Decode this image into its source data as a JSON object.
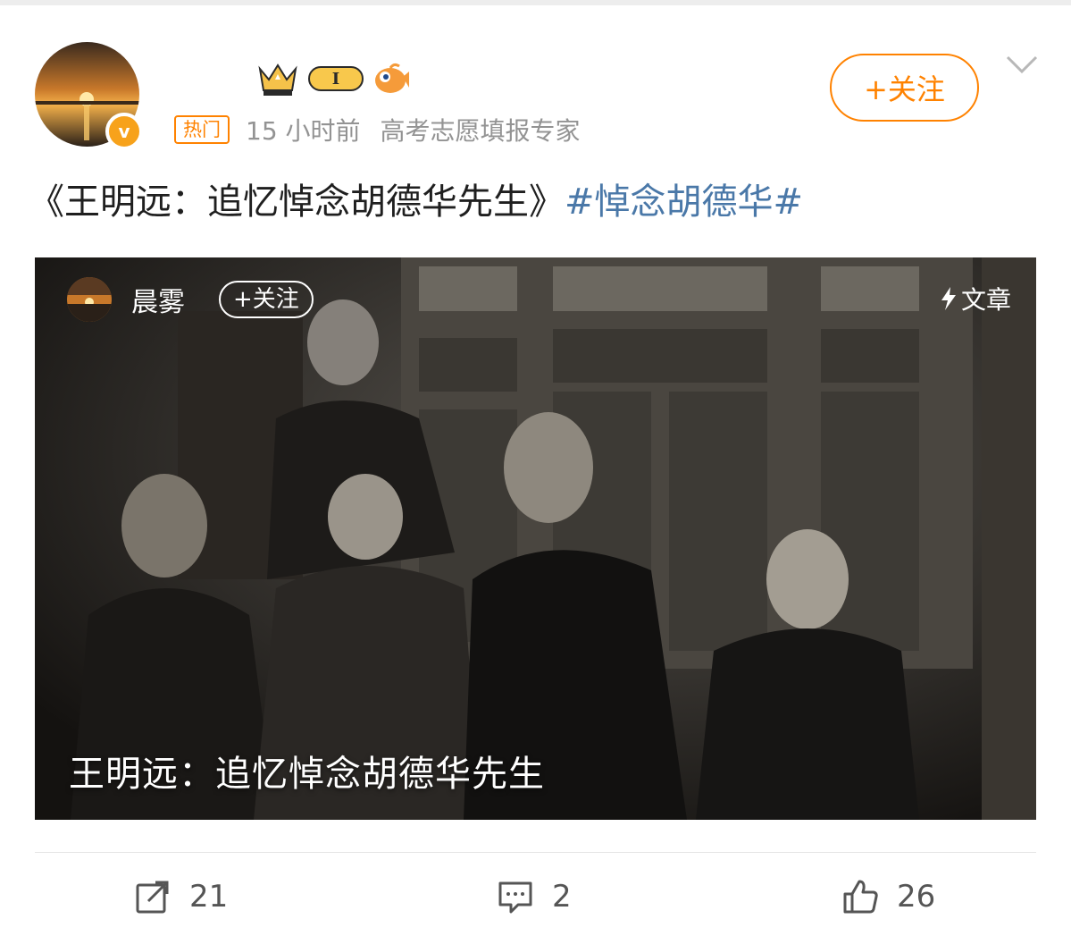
{
  "post": {
    "hot_tag": "热门",
    "time": "15 小时前",
    "source": "高考志愿填报专家",
    "follow_label": "+关注",
    "text_main": "《王明远：追忆悼念胡德华先生》",
    "hashtag": "#悼念胡德华#",
    "level_badge": "I"
  },
  "card": {
    "author_name": "晨雾",
    "follow_label": "+关注",
    "type_label": "文章",
    "title": "王明远：追忆悼念胡德华先生"
  },
  "actions": {
    "share_count": "21",
    "comment_count": "2",
    "like_count": "26"
  },
  "colors": {
    "accent": "#ff8200",
    "hashtag": "#4a78a8",
    "meta_gray": "#939393"
  },
  "icons": [
    "verified-badge-icon",
    "crown-icon",
    "level-icon",
    "fish-icon",
    "chevron-down-icon",
    "bolt-icon",
    "share-icon",
    "comment-icon",
    "like-icon"
  ]
}
